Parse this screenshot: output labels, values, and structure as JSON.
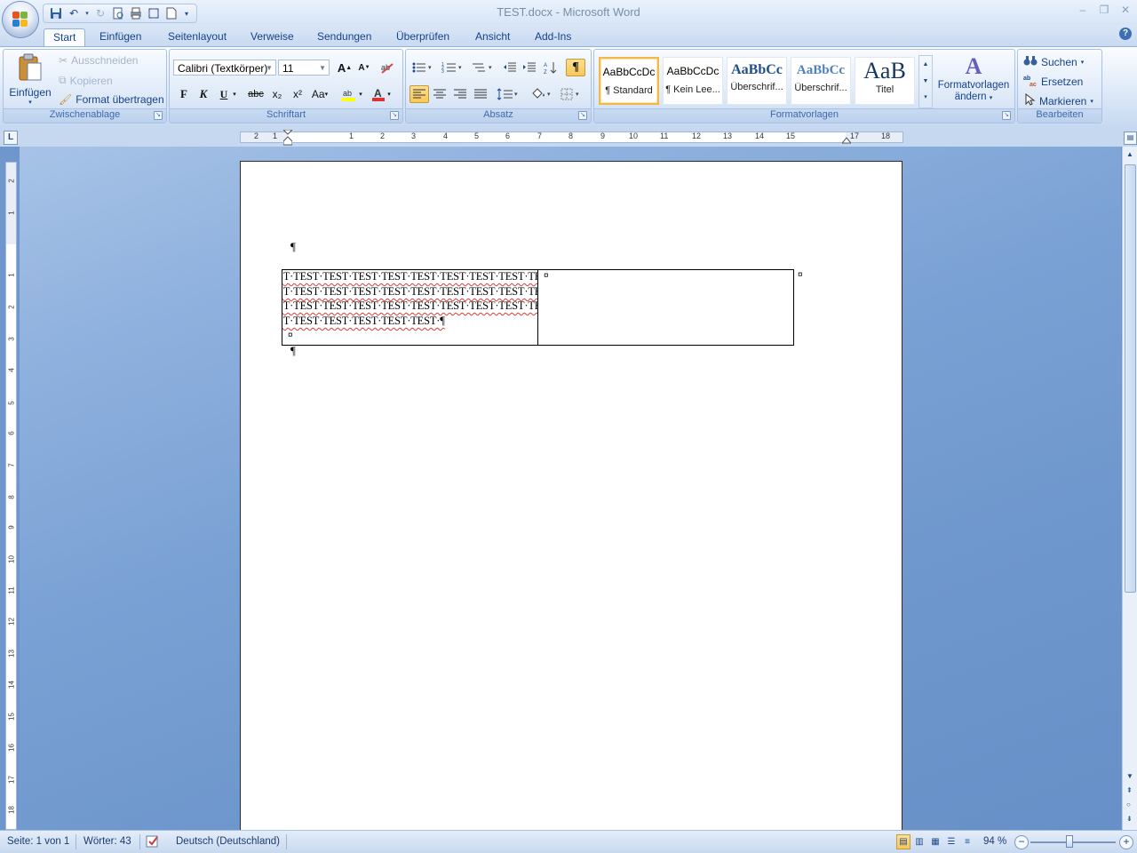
{
  "window": {
    "title": "TEST.docx - Microsoft Word"
  },
  "tabs": [
    "Start",
    "Einfügen",
    "Seitenlayout",
    "Verweise",
    "Sendungen",
    "Überprüfen",
    "Ansicht",
    "Add-Ins"
  ],
  "active_tab": "Start",
  "clipboard": {
    "paste_label": "Einfügen",
    "cut_label": "Ausschneiden",
    "copy_label": "Kopieren",
    "format_painter_label": "Format übertragen",
    "group_label": "Zwischenablage"
  },
  "font": {
    "name": "Calibri (Textkörper)",
    "size": "11",
    "group_label": "Schriftart",
    "bold": "F",
    "italic": "K",
    "underline": "U",
    "strike": "abc",
    "sub": "x₂",
    "sup": "x²",
    "case": "Aa",
    "grow": "A",
    "shrink": "A"
  },
  "paragraph": {
    "group_label": "Absatz",
    "pilcrow": "¶"
  },
  "styles": {
    "group_label": "Formatvorlagen",
    "items": [
      {
        "sample": "AaBbCcDc",
        "name": "¶ Standard"
      },
      {
        "sample": "AaBbCcDc",
        "name": "¶ Kein Lee..."
      },
      {
        "sample": "AaBbCc",
        "name": "Überschrif..."
      },
      {
        "sample": "AaBbCc",
        "name": "Überschrif..."
      },
      {
        "sample": "AaB",
        "name": "Titel"
      }
    ],
    "change_label_1": "Formatvorlagen",
    "change_label_2": "ändern"
  },
  "editing": {
    "group_label": "Bearbeiten",
    "find_label": "Suchen",
    "replace_label": "Ersetzen",
    "select_label": "Markieren"
  },
  "ruler": {
    "corner": "L",
    "numbers": [
      "2",
      "1",
      "1",
      "2",
      "3",
      "4",
      "5",
      "6",
      "7",
      "8",
      "9",
      "10",
      "11",
      "12",
      "13",
      "14",
      "15",
      "17",
      "18"
    ],
    "vnumbers": [
      "2",
      "1",
      "1",
      "2",
      "3",
      "4",
      "5",
      "6",
      "7",
      "8",
      "9",
      "10",
      "11",
      "12",
      "13",
      "14",
      "15",
      "16",
      "17",
      "18"
    ]
  },
  "document": {
    "pilcrow": "¶",
    "cell_mark": "¤",
    "cell1_lines": [
      "ST·TEST·TEST·TEST·TEST·TEST·TEST·TEST·TEST·TEST·TE",
      "ST·TEST·TEST·TEST·TEST·TEST·TEST·TEST·TEST·TEST·TE",
      "ST·TEST·TEST·TEST·TEST·TEST·TEST·TEST·TEST·TEST·TE",
      "ST·TEST·TEST·TEST·TEST·TEST·¶"
    ]
  },
  "status": {
    "page": "Seite: 1 von 1",
    "words": "Wörter: 43",
    "language": "Deutsch (Deutschland)",
    "zoom": "94 %"
  }
}
